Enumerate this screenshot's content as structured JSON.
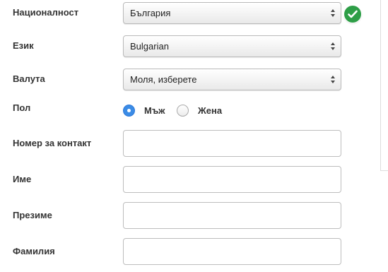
{
  "form": {
    "nationality": {
      "label": "Националност",
      "value": "България",
      "status_icon": "check-circle-icon",
      "status_color": "#2e9e47"
    },
    "language": {
      "label": "Език",
      "value": "Bulgarian"
    },
    "currency": {
      "label": "Валута",
      "value": "Моля, изберете"
    },
    "gender": {
      "label": "Пол",
      "options": [
        {
          "label": "Мъж",
          "checked": true
        },
        {
          "label": "Жена",
          "checked": false
        }
      ]
    },
    "contact_number": {
      "label": "Номер за контакт",
      "value": ""
    },
    "first_name": {
      "label": "Име",
      "value": ""
    },
    "middle_name": {
      "label": "Презиме",
      "value": ""
    },
    "last_name": {
      "label": "Фамилия",
      "value": ""
    }
  },
  "colors": {
    "accent_blue": "#3b8ce6",
    "success_green": "#2e9e47"
  }
}
